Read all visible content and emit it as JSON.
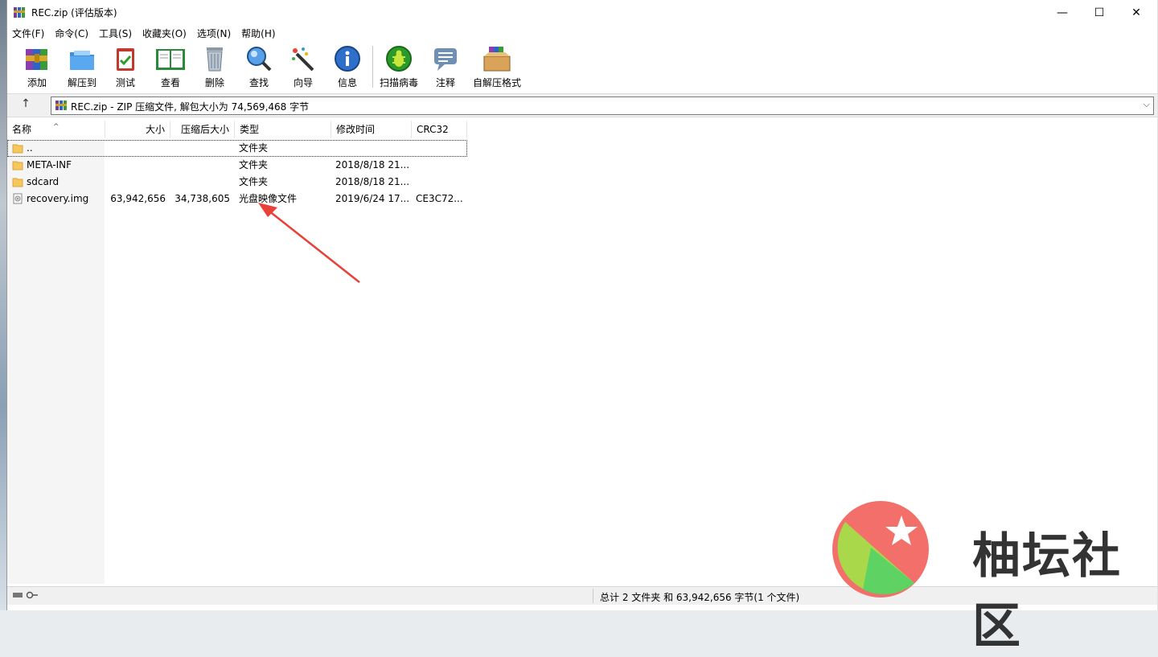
{
  "window": {
    "title": "REC.zip (评估版本)",
    "minimize": "—",
    "maximize": "☐",
    "close": "✕"
  },
  "menu": [
    "文件(F)",
    "命令(C)",
    "工具(S)",
    "收藏夹(O)",
    "选项(N)",
    "帮助(H)"
  ],
  "toolbar": {
    "add": "添加",
    "extract_to": "解压到",
    "test": "测试",
    "view": "查看",
    "delete": "删除",
    "find": "查找",
    "wizard": "向导",
    "info": "信息",
    "virus_scan": "扫描病毒",
    "comment": "注释",
    "sfx": "自解压格式"
  },
  "address": {
    "up": "↑",
    "path": "REC.zip - ZIP 压缩文件, 解包大小为 74,569,468 字节",
    "dropdown": "⌵"
  },
  "columns": {
    "name": "名称",
    "size": "大小",
    "packed": "压缩后大小",
    "type": "类型",
    "modified": "修改时间",
    "crc": "CRC32",
    "sort_indicator": "^"
  },
  "files": [
    {
      "name": "..",
      "size": "",
      "packed": "",
      "type": "文件夹",
      "modified": "",
      "crc": "",
      "icon": "folder-icon"
    },
    {
      "name": "META-INF",
      "size": "",
      "packed": "",
      "type": "文件夹",
      "modified": "2018/8/18 21...",
      "crc": "",
      "icon": "folder-icon"
    },
    {
      "name": "sdcard",
      "size": "",
      "packed": "",
      "type": "文件夹",
      "modified": "2018/8/18 21...",
      "crc": "",
      "icon": "folder-icon"
    },
    {
      "name": "recovery.img",
      "size": "63,942,656",
      "packed": "34,738,605",
      "type": "光盘映像文件",
      "modified": "2019/6/24 17...",
      "crc": "CE3C72...",
      "icon": "disc-image-icon"
    }
  ],
  "status": {
    "text": "总计 2 文件夹 和 63,942,656 字节(1 个文件)"
  },
  "watermark": {
    "text": "柚坛社区"
  },
  "colors": {
    "annotation_arrow": "#e8413a",
    "folder": "#f6c75a",
    "accent": "#0078d7"
  }
}
